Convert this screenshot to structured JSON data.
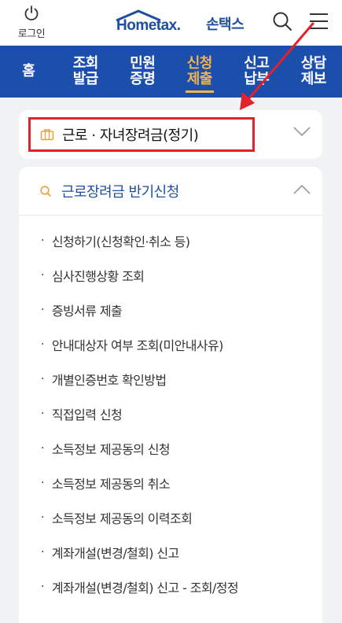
{
  "header": {
    "login_label": "로그인",
    "logo_en": "Hometax.",
    "logo_kr": "손택스",
    "icons": [
      "power-icon",
      "search-icon",
      "menu-icon"
    ]
  },
  "nav": {
    "items": [
      {
        "label": "홈",
        "active": false
      },
      {
        "label": "조회 발급",
        "active": false
      },
      {
        "label": "민원 증명",
        "active": false
      },
      {
        "label": "신청 제출",
        "active": true
      },
      {
        "label": "신고 납부",
        "active": false
      },
      {
        "label": "상담 제보",
        "active": false
      }
    ]
  },
  "category": {
    "title": "근로 · 자녀장려금(정기)",
    "icon": "briefcase-icon"
  },
  "section": {
    "title": "근로장려금 반기신청",
    "icon": "search-icon",
    "items": [
      "신청하기(신청확인·취소 등)",
      "심사진행상황 조회",
      "증빙서류 제출",
      "안내대상자 여부 조회(미안내사유)",
      "개별인증번호 확인방법",
      "직접입력 신청",
      "소득정보 제공동의 신청",
      "소득정보 제공동의 취소",
      "소득정보 제공동의 이력조회",
      "계좌개설(변경/철회) 신고",
      "계좌개설(변경/철회) 신고 - 조회/정정"
    ]
  },
  "colors": {
    "brand": "#1c4eab",
    "active": "#f3b54a",
    "highlight": "#e4202b",
    "section_icon": "#e8a33c"
  }
}
